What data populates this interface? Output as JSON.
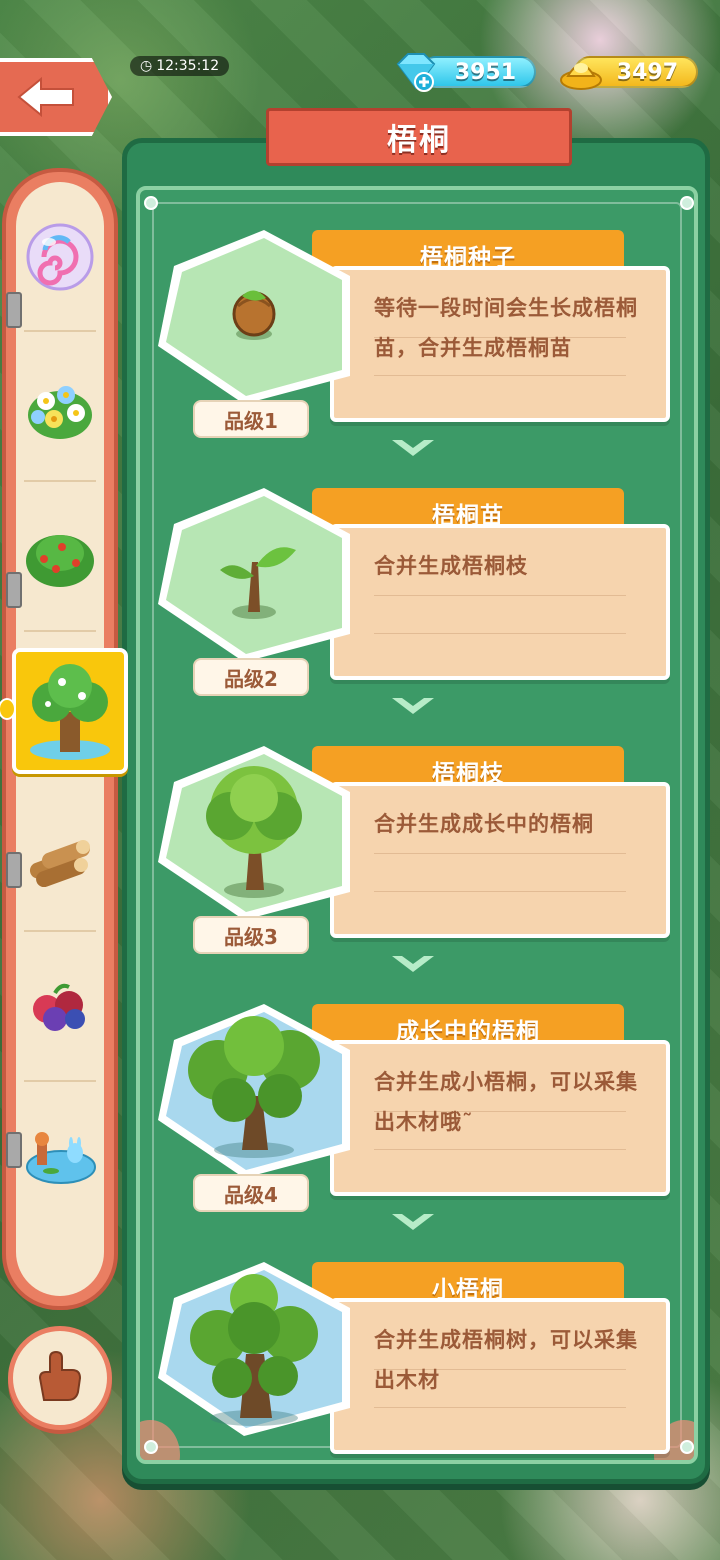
{
  "hud": {
    "timer": "12:35:12",
    "gems": "3951",
    "gold": "3497"
  },
  "panel": {
    "title": "梧桐"
  },
  "sidebar": {
    "items": [
      {
        "icon": "candy-bubble-icon"
      },
      {
        "icon": "flower-bush-icon"
      },
      {
        "icon": "berry-bush-icon"
      },
      {
        "icon": "tree-icon",
        "active": true
      },
      {
        "icon": "wood-logs-icon"
      },
      {
        "icon": "berries-icon"
      },
      {
        "icon": "pond-icon"
      }
    ]
  },
  "cards": [
    {
      "name": "梧桐种子",
      "desc": "等待一段时间会生长成梧桐苗，合并生成梧桐苗",
      "grade": "品级1",
      "icon": "seed-icon",
      "bg": "#b7e6b4"
    },
    {
      "name": "梧桐苗",
      "desc": "合并生成梧桐枝",
      "grade": "品级2",
      "icon": "sapling-icon",
      "bg": "#b7e6b4"
    },
    {
      "name": "梧桐枝",
      "desc": "合并生成成长中的梧桐",
      "grade": "品级3",
      "icon": "young-tree-icon",
      "bg": "#b7e6b4"
    },
    {
      "name": "成长中的梧桐",
      "desc": "合并生成小梧桐，可以采集出木材哦˜",
      "grade": "品级4",
      "icon": "growing-tree-icon",
      "bg": "#a9d8ee"
    },
    {
      "name": "小梧桐",
      "desc": "合并生成梧桐树，可以采集出木材",
      "grade": "",
      "icon": "small-tree-icon",
      "bg": "#a9d8ee"
    }
  ]
}
